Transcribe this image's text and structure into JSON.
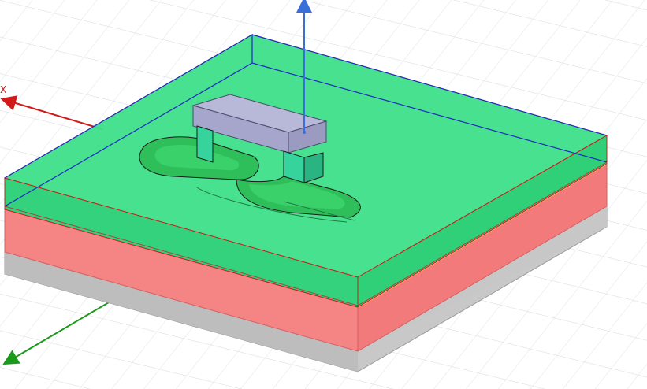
{
  "view": {
    "background": "#ffffff",
    "grid_color": "#d8dde2"
  },
  "axes": {
    "x": {
      "label": "X",
      "color": "#d11a1a"
    },
    "y": {
      "label": "",
      "color": "#1a9a1a"
    },
    "z": {
      "label": "",
      "color": "#3a6fd8"
    }
  },
  "layers": {
    "ground": {
      "color": "#c8c8c8"
    },
    "substrate": {
      "color": "#f58484"
    },
    "air_box": {
      "color": "#3ee08a",
      "edge_color": "#1e2cc0"
    },
    "bridge": {
      "color": "#a6a6cc"
    },
    "coil": {
      "color": "#2fbf5a",
      "edge_color": "#1a1a1a"
    }
  }
}
